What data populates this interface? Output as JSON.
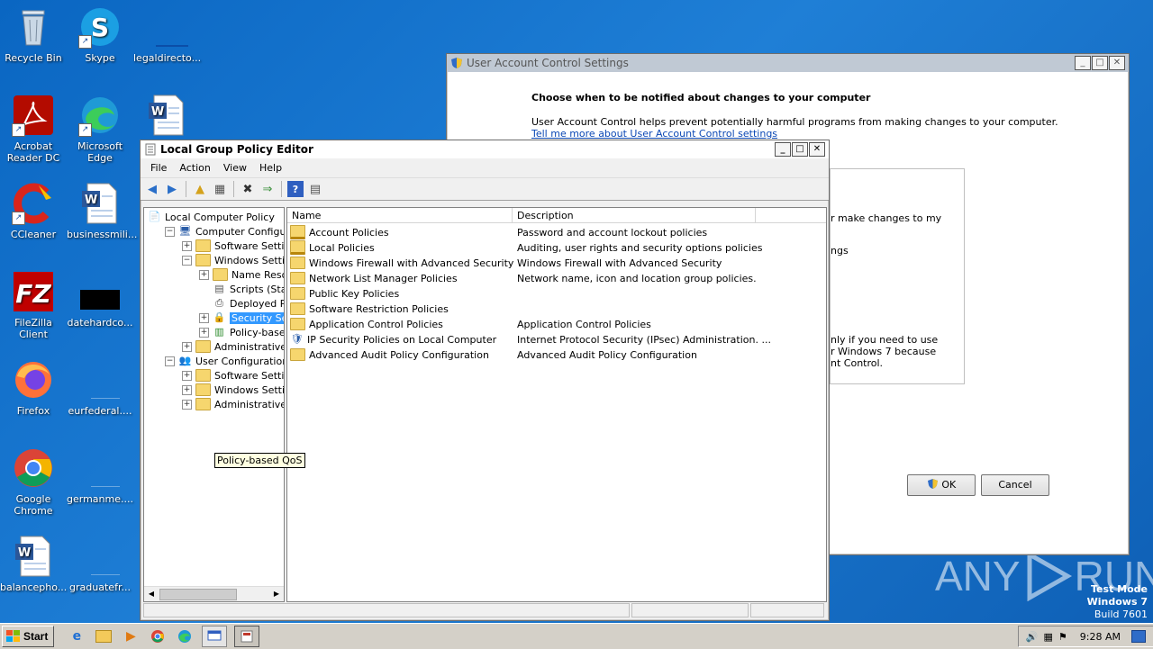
{
  "desktop": {
    "icons": [
      {
        "label": "Recycle Bin",
        "icon": "recycle-bin-icon"
      },
      {
        "label": "Skype",
        "icon": "skype-icon"
      },
      {
        "label": "legaldirecto...",
        "icon": "file-icon"
      },
      {
        "label": "Acrobat Reader DC",
        "icon": "acrobat-icon"
      },
      {
        "label": "Microsoft Edge",
        "icon": "edge-icon"
      },
      {
        "label": "CCleaner",
        "icon": "ccleaner-icon"
      },
      {
        "label": "businessmili...",
        "icon": "word-doc-icon"
      },
      {
        "label": "FileZilla Client",
        "icon": "filezilla-icon"
      },
      {
        "label": "datehardco...",
        "icon": "file-icon"
      },
      {
        "label": "Firefox",
        "icon": "firefox-icon"
      },
      {
        "label": "eurfederal....",
        "icon": "file-icon"
      },
      {
        "label": "Google Chrome",
        "icon": "chrome-icon"
      },
      {
        "label": "germanme....",
        "icon": "file-icon"
      },
      {
        "label": "balancepho...",
        "icon": "word-doc-icon"
      },
      {
        "label": "graduatefr...",
        "icon": "file-icon"
      }
    ],
    "watermark": {
      "left": "ANY",
      "right": "RUN"
    },
    "os_info": {
      "line1": "Test Mode",
      "line2": "Windows 7",
      "line3": "Build 7601"
    }
  },
  "uac": {
    "title": "User Account Control Settings",
    "heading": "Choose when to be notified about changes to your computer",
    "intro": "User Account Control helps prevent potentially harmful programs from making changes to your computer.",
    "link": "Tell me more about User Account Control settings",
    "frag1": "r make changes to my",
    "frag2": "ngs",
    "frag3": "nly if you need to use",
    "frag4": "r Windows 7 because",
    "frag5": "nt Control.",
    "ok": "OK",
    "cancel": "Cancel"
  },
  "gpe": {
    "title": "Local Group Policy Editor",
    "menu": [
      "File",
      "Action",
      "View",
      "Help"
    ],
    "tree": [
      {
        "label": "Local Computer Policy",
        "depth": 0,
        "expander": "",
        "icon": "policy"
      },
      {
        "label": "Computer Configuratio",
        "depth": 1,
        "expander": "−",
        "icon": "computer"
      },
      {
        "label": "Software Settings",
        "depth": 2,
        "expander": "+",
        "icon": "folder"
      },
      {
        "label": "Windows Settings",
        "depth": 2,
        "expander": "−",
        "icon": "folder"
      },
      {
        "label": "Name Resolutic",
        "depth": 3,
        "expander": "+",
        "icon": "folder"
      },
      {
        "label": "Scripts (Startup",
        "depth": 3,
        "expander": "",
        "icon": "scripts"
      },
      {
        "label": "Deployed Printe",
        "depth": 3,
        "expander": "",
        "icon": "printer"
      },
      {
        "label": "Security Setting",
        "depth": 3,
        "expander": "+",
        "icon": "security",
        "selected": true
      },
      {
        "label": "Policy-based Q",
        "depth": 3,
        "expander": "+",
        "icon": "qos"
      },
      {
        "label": "Administrative Tem",
        "depth": 2,
        "expander": "+",
        "icon": "folder"
      },
      {
        "label": "User Configuration",
        "depth": 1,
        "expander": "−",
        "icon": "user"
      },
      {
        "label": "Software Settings",
        "depth": 2,
        "expander": "+",
        "icon": "folder"
      },
      {
        "label": "Windows Settings",
        "depth": 2,
        "expander": "+",
        "icon": "folder"
      },
      {
        "label": "Administrative Tem",
        "depth": 2,
        "expander": "+",
        "icon": "folder"
      }
    ],
    "columns": {
      "name": "Name",
      "description": "Description"
    },
    "rows": [
      {
        "name": "Account Policies",
        "description": "Password and account lockout policies",
        "icon": "lock-folder"
      },
      {
        "name": "Local Policies",
        "description": "Auditing, user rights and security options policies",
        "icon": "lock-folder"
      },
      {
        "name": "Windows Firewall with Advanced Security",
        "description": "Windows Firewall with Advanced Security",
        "icon": "folder"
      },
      {
        "name": "Network List Manager Policies",
        "description": "Network name, icon and location group policies.",
        "icon": "folder"
      },
      {
        "name": "Public Key Policies",
        "description": "",
        "icon": "folder"
      },
      {
        "name": "Software Restriction Policies",
        "description": "",
        "icon": "folder"
      },
      {
        "name": "Application Control Policies",
        "description": "Application Control Policies",
        "icon": "folder"
      },
      {
        "name": "IP Security Policies on Local Computer",
        "description": "Internet Protocol Security (IPsec) Administration. ...",
        "icon": "ipsec"
      },
      {
        "name": "Advanced Audit Policy Configuration",
        "description": "Advanced Audit Policy Configuration",
        "icon": "folder"
      }
    ],
    "tooltip": "Policy-based QoS"
  },
  "taskbar": {
    "start": "Start",
    "time": "9:28 AM"
  }
}
